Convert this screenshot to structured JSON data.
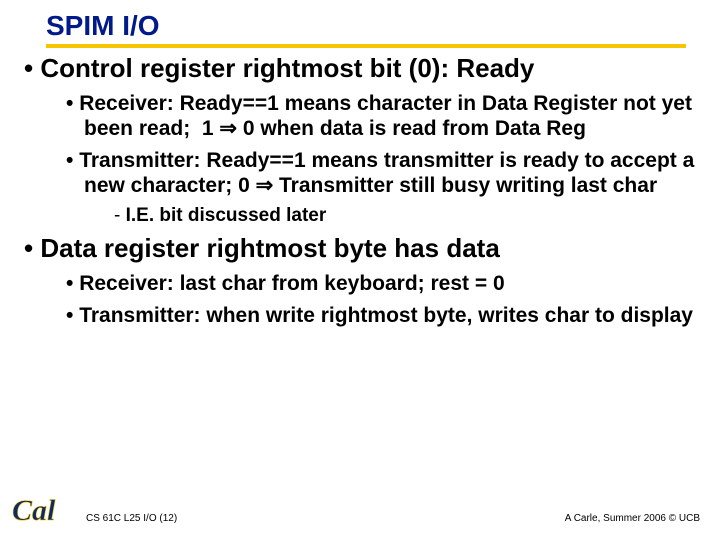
{
  "title": "SPIM I/O",
  "bullets": {
    "b1": "Control register rightmost bit (0): Ready",
    "b1a": "Receiver: Ready==1 means character in Data Register not yet been read;  1 ⇒ 0 when data is read from Data Reg",
    "b1b": "Transmitter: Ready==1 means transmitter is ready to accept a new character; 0 ⇒ Transmitter still busy writing last char",
    "b1b_i": "I.E. bit discussed later",
    "b2": "Data register rightmost byte has data",
    "b2a": "Receiver: last char from keyboard; rest = 0",
    "b2b": "Transmitter: when write rightmost byte, writes char to display"
  },
  "footer": {
    "left": "CS 61C L25 I/O (12)",
    "right": "A Carle, Summer 2006 © UCB"
  }
}
